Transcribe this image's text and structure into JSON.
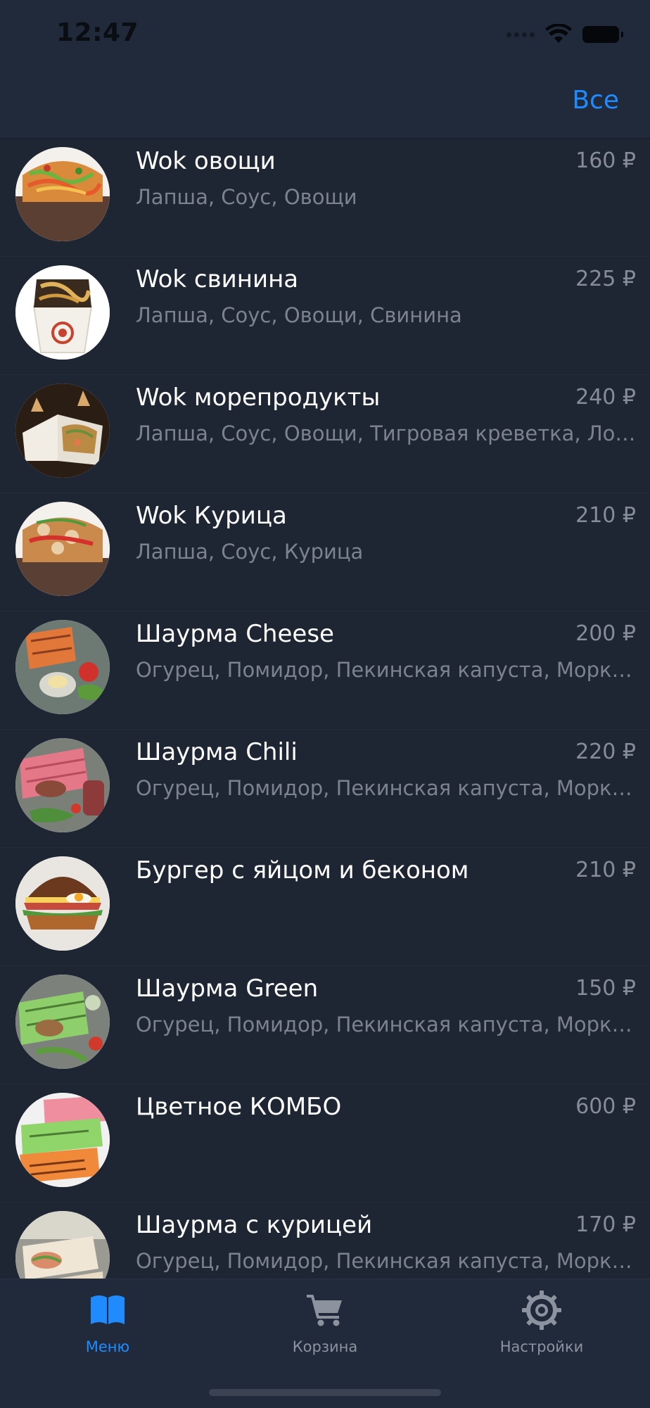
{
  "status_bar": {
    "time": "12:47"
  },
  "nav": {
    "filter_label": "Все"
  },
  "menu_items": [
    {
      "title": "Wok овощи",
      "price": "160 ₽",
      "description": "Лапша, Соус, Овощи"
    },
    {
      "title": "Wok свинина",
      "price": "225 ₽",
      "description": "Лапша, Соус, Овощи, Свинина"
    },
    {
      "title": "Wok морепродукты",
      "price": "240 ₽",
      "description": "Лапша, Соус, Овощи, Тигровая креветка, Лос..."
    },
    {
      "title": "Wok Курица",
      "price": "210 ₽",
      "description": "Лапша, Соус, Курица"
    },
    {
      "title": "Шаурма Cheese",
      "price": "200 ₽",
      "description": "Огурец, Помидор, Пекинская капуста, Морко..."
    },
    {
      "title": "Шаурма Chili",
      "price": "220 ₽",
      "description": "Огурец, Помидор, Пекинская капуста, Морко..."
    },
    {
      "title": "Бургер с яйцом и беконом",
      "price": "210 ₽",
      "description": ""
    },
    {
      "title": "Шаурма Green",
      "price": "150 ₽",
      "description": "Огурец, Помидор, Пекинская капуста, Морко..."
    },
    {
      "title": "Цветное КОМБО",
      "price": "600 ₽",
      "description": ""
    },
    {
      "title": "Шаурма с курицей",
      "price": "170 ₽",
      "description": "Огурец, Помидор, Пекинская капуста, Морко..."
    }
  ],
  "tab_bar": {
    "tabs": [
      {
        "label": "Меню",
        "icon": "book-icon",
        "active": true
      },
      {
        "label": "Корзина",
        "icon": "cart-icon",
        "active": false
      },
      {
        "label": "Настройки",
        "icon": "gear-icon",
        "active": false
      }
    ]
  },
  "colors": {
    "background": "#1e2533",
    "bar_background": "#212a3a",
    "accent": "#1f8bff",
    "secondary_text": "#7c828f"
  }
}
